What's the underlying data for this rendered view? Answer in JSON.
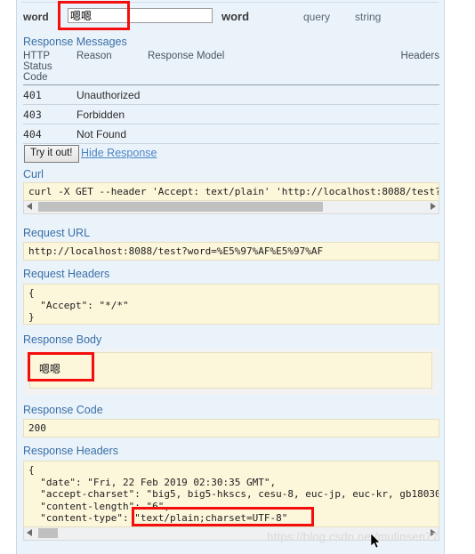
{
  "panel": {
    "parameter": {
      "name": "word",
      "value": "嗯嗯",
      "description": "word",
      "param_type": "query",
      "data_type": "string"
    },
    "response_messages": {
      "heading": "Response Messages",
      "columns": {
        "status_code": "HTTP Status Code",
        "reason": "Reason",
        "response_model": "Response Model",
        "headers": "Headers"
      },
      "rows": [
        {
          "code": "401",
          "reason": "Unauthorized",
          "model": "",
          "headers": ""
        },
        {
          "code": "403",
          "reason": "Forbidden",
          "model": "",
          "headers": ""
        },
        {
          "code": "404",
          "reason": "Not Found",
          "model": "",
          "headers": ""
        }
      ]
    },
    "actions": {
      "try_it_out": "Try it out!",
      "hide_response": "Hide Response"
    },
    "curl": {
      "heading": "Curl",
      "command": "curl -X GET --header 'Accept: text/plain' 'http://localhost:8088/test?"
    },
    "request_url": {
      "heading": "Request URL",
      "value": "http://localhost:8088/test?word=%E5%97%AF%E5%97%AF"
    },
    "request_headers": {
      "heading": "Request Headers",
      "value": "{\n  \"Accept\": \"*/*\"\n}"
    },
    "response_body": {
      "heading": "Response Body",
      "value": "嗯嗯"
    },
    "response_code": {
      "heading": "Response Code",
      "value": "200"
    },
    "response_headers": {
      "heading": "Response Headers",
      "value": "{\n  \"date\": \"Fri, 22 Feb 2019 02:30:35 GMT\",\n  \"accept-charset\": \"big5, big5-hkscs, cesu-8, euc-jp, euc-kr, gb18030\n  \"content-length\": \"6\",\n  \"content-type\": \"text/plain;charset=UTF-8\"\n}"
    }
  },
  "annotations": {
    "highlight_color": "#f40d0d",
    "boxes": [
      {
        "label": "word-input-highlight"
      },
      {
        "label": "response-body-highlight"
      },
      {
        "label": "content-type-highlight"
      }
    ]
  },
  "watermark": {
    "text": "https://blog.csdn.net/mulinsen77"
  }
}
